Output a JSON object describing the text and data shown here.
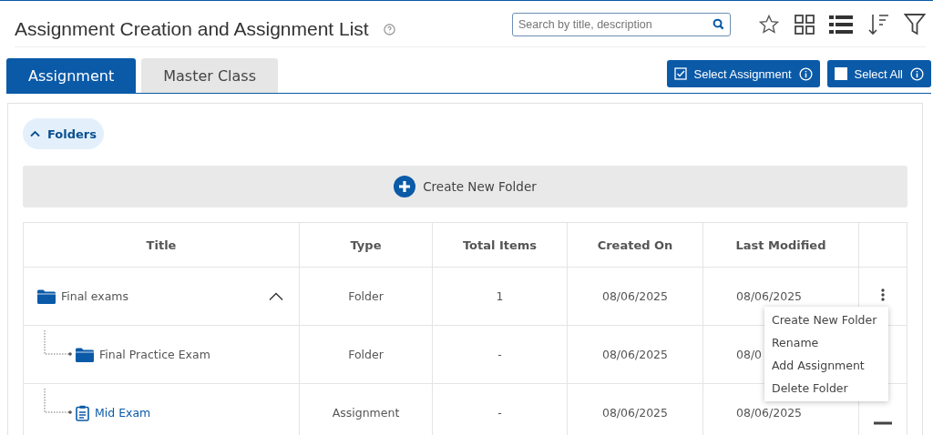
{
  "header": {
    "title": "Assignment Creation and Assignment List",
    "search": {
      "placeholder": "Search by title, description"
    }
  },
  "tabs": [
    {
      "label": "Assignment",
      "selected": true
    },
    {
      "label": "Master Class",
      "selected": false
    }
  ],
  "actions": [
    {
      "label": "Select Assignment",
      "kind": "check"
    },
    {
      "label": "Select All",
      "kind": "square"
    }
  ],
  "folders_toggle": {
    "label": "Folders",
    "expanded": true
  },
  "create_folder": {
    "label": "Create New Folder"
  },
  "table": {
    "columns": [
      "Title",
      "Type",
      "Total Items",
      "Created On",
      "Last Modified"
    ],
    "rows": [
      {
        "kind": "folder",
        "title": "Final exams",
        "expanded": true,
        "nested": false,
        "type": "Folder",
        "total_items": "1",
        "created_on": "08/06/2025",
        "last_modified": "08/06/2025",
        "action": {
          "kind": "menu"
        }
      },
      {
        "kind": "folder",
        "title": "Final Practice Exam",
        "nested": true,
        "type": "Folder",
        "total_items": "-",
        "created_on": "08/06/2025",
        "last_modified": "08/0"
      },
      {
        "kind": "assignment",
        "title": "Mid Exam",
        "nested": true,
        "type": "Assignment",
        "total_items": "-",
        "created_on": "08/06/2025",
        "last_modified": "08/06/2025",
        "action": {
          "kind": "dash"
        }
      }
    ]
  },
  "context_menu": [
    "Create New Folder",
    "Rename",
    "Add Assignment",
    "Delete Folder"
  ]
}
